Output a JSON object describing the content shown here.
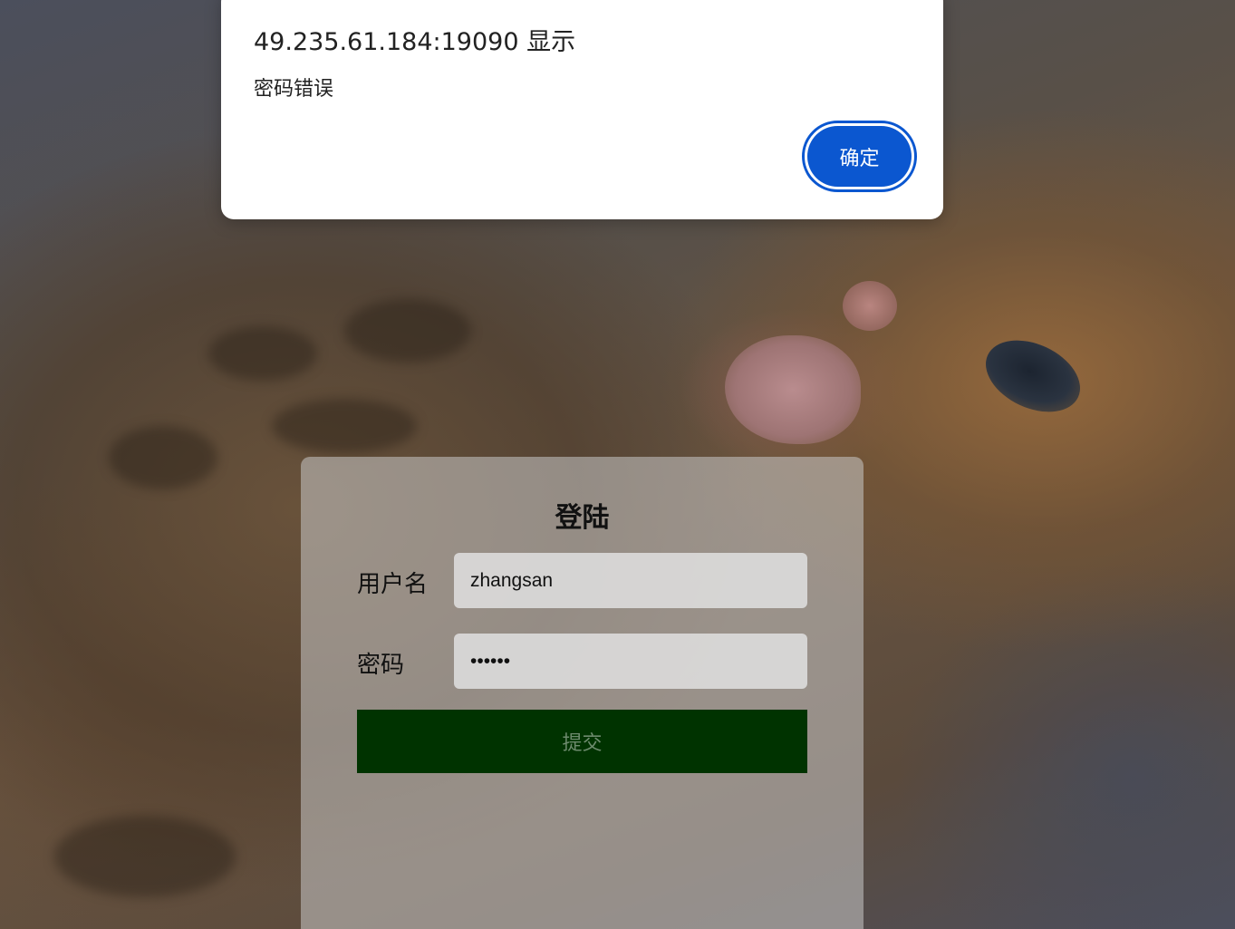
{
  "alert": {
    "origin": "49.235.61.184:19090 显示",
    "message": "密码错误",
    "ok_label": "确定",
    "accent_color": "#0b57d0"
  },
  "login": {
    "title": "登陆",
    "username_label": "用户名",
    "username_value": "zhangsan",
    "password_label": "密码",
    "password_value": "••••••",
    "submit_label": "提交",
    "submit_color": "#003300"
  },
  "background": {
    "description_icon": "kitten-photo"
  }
}
